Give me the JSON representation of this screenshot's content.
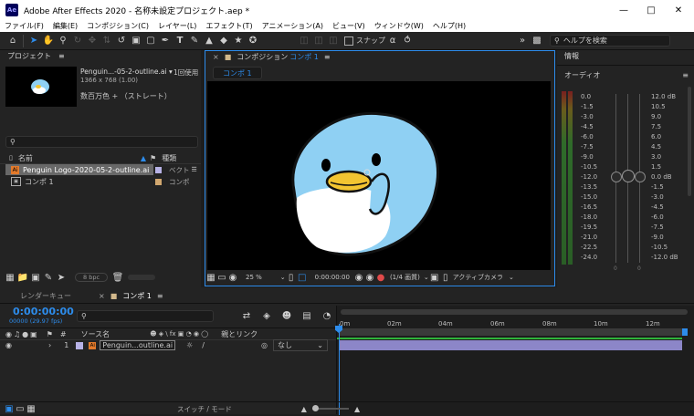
{
  "window": {
    "app_icon": "Ae",
    "title": "Adobe After Effects 2020 - 名称未設定プロジェクト.aep *",
    "minimize_icon": "minimize-icon",
    "maximize_icon": "maximize-icon",
    "close_icon": "close-icon"
  },
  "menu": [
    "ファイル(F)",
    "編集(E)",
    "コンポジション(C)",
    "レイヤー(L)",
    "エフェクト(T)",
    "アニメーション(A)",
    "ビュー(V)",
    "ウィンドウ(W)",
    "ヘルプ(H)"
  ],
  "toolbar": {
    "snap_label": "スナップ",
    "search_placeholder": "ヘルプを検索"
  },
  "project": {
    "panel_title": "プロジェクト",
    "menu_glyph": "≡",
    "selected_name": "Penguin...-05-2-outline.ai ▾",
    "usage": "1回使用",
    "dimensions": "1366 x 768 (1.00)",
    "color_info": "数百万色 + （ストレート）",
    "col_name": "名前",
    "col_type": "種類",
    "items": [
      {
        "name": "Penguin Logo-2020-05-2-outline.ai",
        "type": "ベクト"
      },
      {
        "name": "コンポ 1",
        "type": "コンポ"
      }
    ],
    "bpc": "8 bpc"
  },
  "composition": {
    "panel_title": "コンポジション",
    "comp_name": "コンポ 1",
    "tab_label": "コンポ 1",
    "zoom": "25 %",
    "timecode": "0:00:00:00",
    "resolution": "(1/4 画質)",
    "camera": "アクティブカメラ"
  },
  "info": {
    "panel_title": "情報",
    "audio_title": "オーディオ",
    "left_scale": [
      "0.0",
      "-1.5",
      "-3.0",
      "-4.5",
      "-6.0",
      "-7.5",
      "-9.0",
      "-10.5",
      "-12.0",
      "-13.5",
      "-15.0",
      "-16.5",
      "-18.0",
      "-19.5",
      "-21.0",
      "-22.5",
      "-24.0"
    ],
    "right_scale": [
      "12.0 dB",
      "10.5",
      "9.0",
      "7.5",
      "6.0",
      "4.5",
      "3.0",
      "1.5",
      "0.0 dB",
      "-1.5",
      "-3.0",
      "-4.5",
      "-6.0",
      "-7.5",
      "-9.0",
      "-10.5",
      "-12.0 dB"
    ],
    "zero_label_left": "0",
    "zero_label_right": "0"
  },
  "timeline": {
    "tab_render": "レンダーキュー",
    "tab_comp": "コンポ 1",
    "timecode": "0:00:00:00",
    "frame_info": "00000 (29.97 fps)",
    "col_source": "ソース名",
    "col_parent": "親とリンク",
    "layer_num": "1",
    "layer_name": "Penguin...outline.ai",
    "parent_value": "なし",
    "ruler": [
      "0m",
      "02m",
      "04m",
      "06m",
      "08m",
      "10m",
      "12m"
    ],
    "switch_mode": "スイッチ / モード"
  },
  "colors": {
    "accent": "#2d8ceb",
    "penguin_body": "#8fd0f3",
    "penguin_belly": "#ffffff",
    "beak": "#f2c431",
    "layer_bar": "#8c86c8"
  }
}
